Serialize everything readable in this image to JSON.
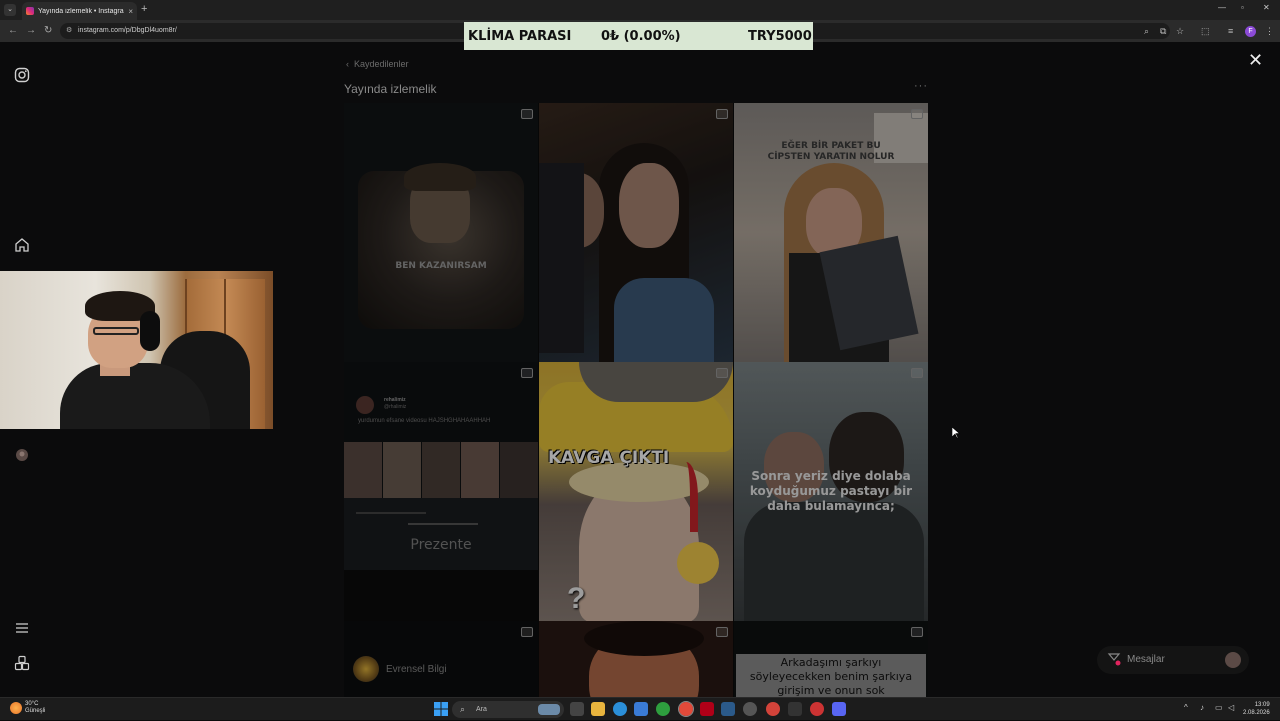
{
  "browser": {
    "tab_title": "Yayında izlemelik • Instagram",
    "url": "instagram.com/p/DbgDl4uom8r/",
    "new_tab": "+",
    "close_tab": "×",
    "profile_initial": "F"
  },
  "ticker": {
    "name": "KLİMA PARASI",
    "change": "0₺ (0.00%)",
    "target": "TRY5000"
  },
  "collection": {
    "breadcrumb": "Kaydedilenler",
    "title": "Yayında izlemelik",
    "more": "···"
  },
  "tiles": {
    "t1_caption": "BEN KAZANIRSAM",
    "t3_caption": "EĞER BİR PAKET BU CİPSTEN YARATIN NOLUR",
    "t4_user": "rehalimiz",
    "t4_handle": "@rhalimiz",
    "t4_text": "yurdumun efsane videosu HAJSHGHAHAAHHAH",
    "t4_present": "Prezente",
    "t5_caption": "KAVGA ÇIKTI",
    "t6_caption": "Sonra yeriz diye dolaba koyduğumuz pastayı bir daha bulamayınca;",
    "t7_user": "Evrensel Bilgi",
    "t9_caption": "Arkadaşımı şarkıyı söyleyecekken benim şarkıya girişim ve onun sok"
  },
  "messages": {
    "label": "Mesajlar"
  },
  "taskbar": {
    "weather_temp": "30°C",
    "weather_desc": "Güneşli",
    "search_placeholder": "Ara",
    "time": "13:09",
    "date": "2.08.2026"
  },
  "colors": {
    "ticker_bg": "#d9e7d3",
    "taxi_yellow": "#f2c230",
    "kavga_red": "#c8262c"
  }
}
